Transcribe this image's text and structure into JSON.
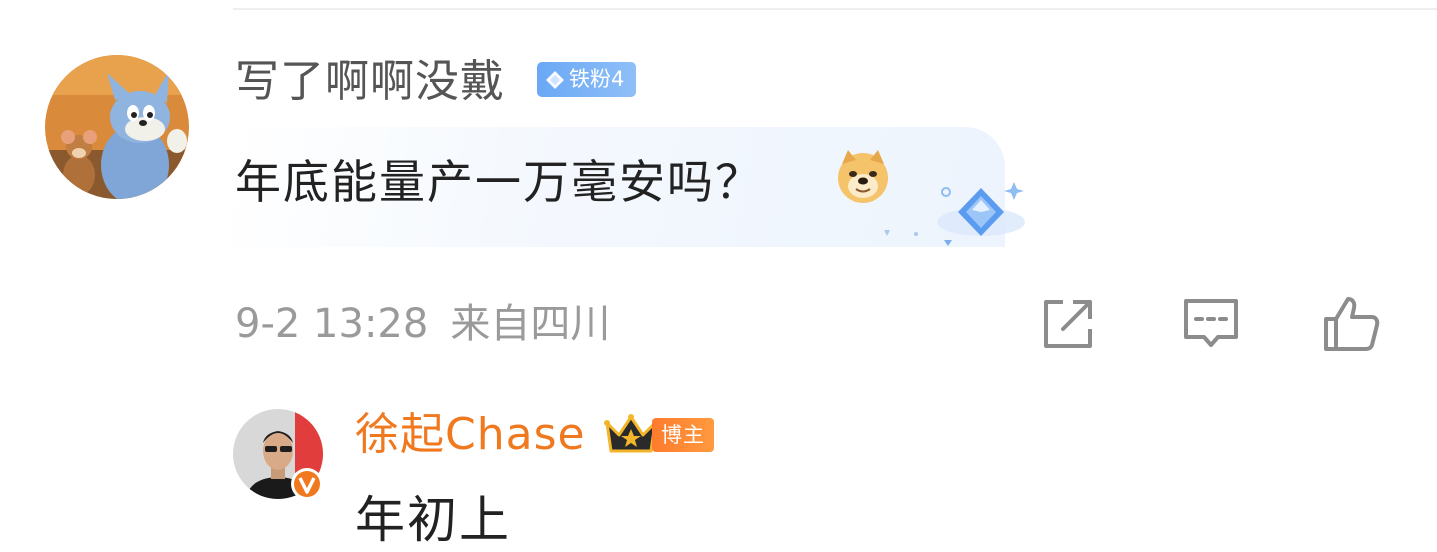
{
  "comment": {
    "username": "写了啊啊没戴",
    "fan_badge": "铁粉4",
    "text": "年底能量产一万毫安吗？",
    "emoji_icon": "doge-emoji",
    "timestamp": "9-2 13:28",
    "location": "来自四川",
    "avatar_icon": "cartoon-cat-mouse-avatar"
  },
  "actions": {
    "share_icon": "share-icon",
    "comment_icon": "comment-icon",
    "like_icon": "like-icon"
  },
  "reply": {
    "username": "徐起Chase",
    "badge": "博主",
    "text": "年初上",
    "avatar_icon": "person-avatar",
    "verified_icon": "verified-v-icon"
  },
  "colors": {
    "username_gray": "#555555",
    "meta_gray": "#9a9a9a",
    "author_orange": "#f0781e",
    "fan_badge_blue": "#6aa8f5",
    "blogger_badge_orange": "#ff7b2e"
  }
}
